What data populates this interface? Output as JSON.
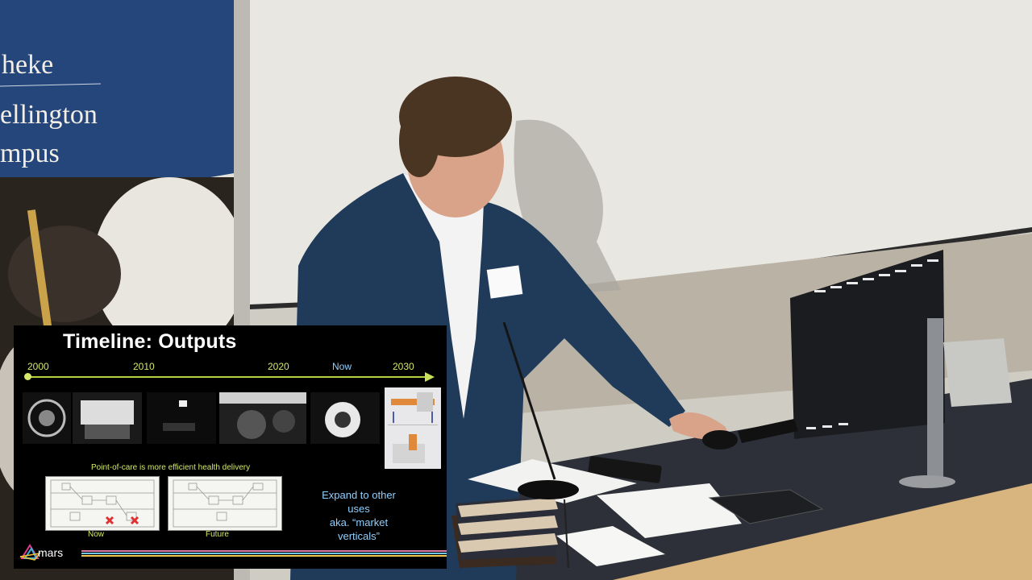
{
  "banner": {
    "line1": "heke",
    "line2": "ellington",
    "line3": "mpus"
  },
  "slide": {
    "title": "Timeline:  Outputs",
    "timeline": [
      {
        "label": "2000"
      },
      {
        "label": "2010"
      },
      {
        "label": "2020"
      },
      {
        "label": "Now"
      },
      {
        "label": "2030"
      }
    ],
    "caption": "Point-of-care is more efficient health delivery",
    "diagrams": [
      {
        "label": "Now"
      },
      {
        "label": "Future"
      }
    ],
    "expand_line1": "Expand to other uses",
    "expand_line2": "aka. “market verticals”",
    "brand": "mars"
  },
  "colors": {
    "timeline_accent": "#b4d23c",
    "now_accent": "#8fd0ff",
    "banner_blue": "#1d3d6e",
    "desk": "#2d3038"
  }
}
